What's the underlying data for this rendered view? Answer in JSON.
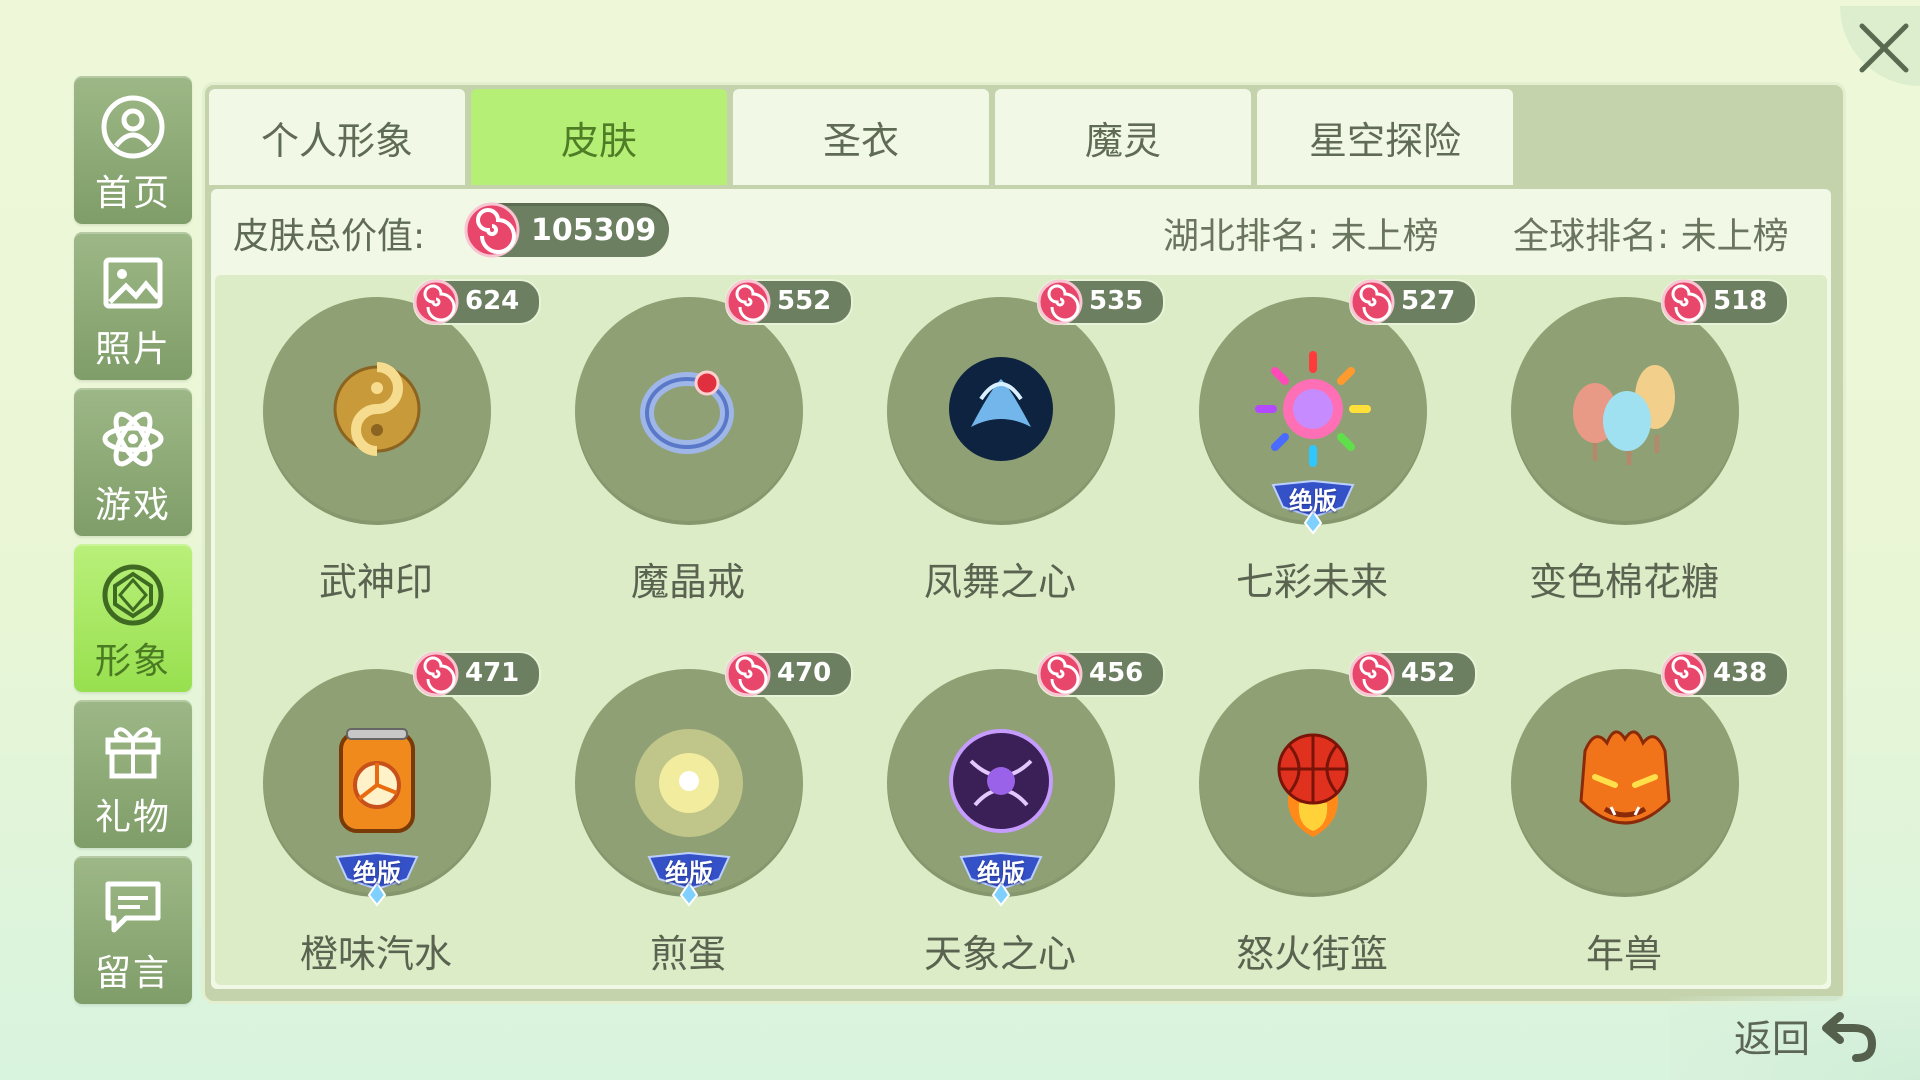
{
  "sidebar": {
    "items": [
      {
        "label": "首页",
        "icon": "home-user-icon",
        "active": false
      },
      {
        "label": "照片",
        "icon": "photo-icon",
        "active": false
      },
      {
        "label": "游戏",
        "icon": "atom-icon",
        "active": false
      },
      {
        "label": "形象",
        "icon": "gem-icon",
        "active": true
      },
      {
        "label": "礼物",
        "icon": "gift-icon",
        "active": false
      },
      {
        "label": "留言",
        "icon": "message-icon",
        "active": false
      }
    ]
  },
  "tabs": [
    {
      "label": "个人形象",
      "active": false
    },
    {
      "label": "皮肤",
      "active": true
    },
    {
      "label": "圣衣",
      "active": false
    },
    {
      "label": "魔灵",
      "active": false
    },
    {
      "label": "星空探险",
      "active": false
    }
  ],
  "stats": {
    "total_label": "皮肤总价值:",
    "total_value": "105309",
    "local_rank": "湖北排名: 未上榜",
    "global_rank": "全球排名: 未上榜"
  },
  "items": [
    {
      "name": "武神印",
      "price": "624",
      "badge": "",
      "art": "swirl-gold-icon"
    },
    {
      "name": "魔晶戒",
      "price": "552",
      "badge": "",
      "art": "ring-icon"
    },
    {
      "name": "凤舞之心",
      "price": "535",
      "badge": "",
      "art": "phoenix-orb-icon"
    },
    {
      "name": "七彩未来",
      "price": "527",
      "badge": "绝版",
      "art": "rainbow-sun-icon"
    },
    {
      "name": "变色棉花糖",
      "price": "518",
      "badge": "",
      "art": "cotton-candy-icon"
    },
    {
      "name": "橙味汽水",
      "price": "471",
      "badge": "绝版",
      "art": "orange-soda-can-icon"
    },
    {
      "name": "煎蛋",
      "price": "470",
      "badge": "绝版",
      "art": "fried-egg-icon"
    },
    {
      "name": "天象之心",
      "price": "456",
      "badge": "绝版",
      "art": "purple-orb-icon"
    },
    {
      "name": "怒火街篮",
      "price": "452",
      "badge": "",
      "art": "flaming-basketball-icon"
    },
    {
      "name": "年兽",
      "price": "438",
      "badge": "",
      "art": "fire-beast-icon"
    }
  ],
  "footer": {
    "back_label": "返回"
  },
  "colors": {
    "accent_green": "#b6ef76",
    "sidebar_green": "#8ca877",
    "item_circle": "#8fa174",
    "price_pill": "#6c7f60"
  }
}
